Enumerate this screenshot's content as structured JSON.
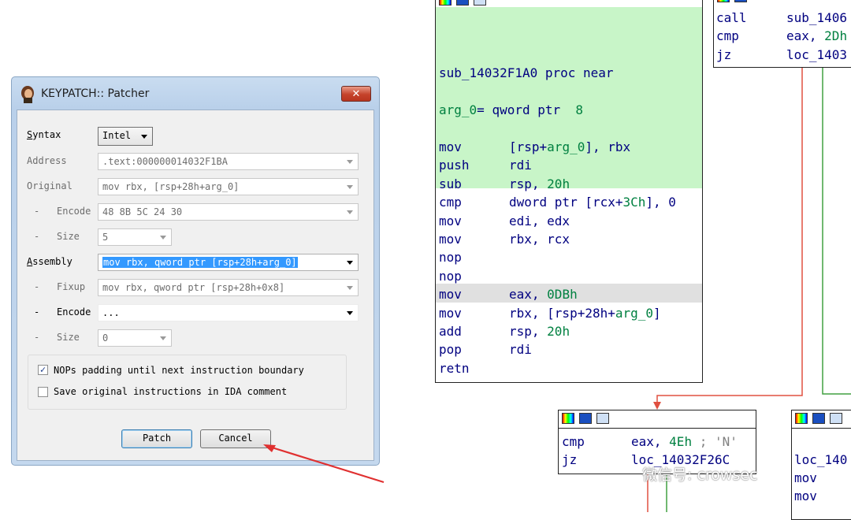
{
  "dialog": {
    "title": "KEYPATCH:: Patcher",
    "close_glyph": "✕",
    "syntax_label_u": "S",
    "syntax_label_rest": "yntax",
    "syntax_value": "Intel",
    "address_label": "Address",
    "address_value": ".text:000000014032F1BA",
    "original_label": "Original",
    "original_value": "mov rbx, [rsp+28h+arg_0]",
    "dash": "-",
    "encode_label": "Encode",
    "encode_value": "48 8B 5C 24 30",
    "size_label": "Size",
    "size_value": "5",
    "assembly_label_u": "A",
    "assembly_label_rest": "ssembly",
    "assembly_value": "mov rbx, qword ptr [rsp+28h+arg_0]",
    "fixup_label": "Fixup",
    "fixup_value": "mov rbx, qword ptr [rsp+28h+0x8]",
    "encode2_label": "Encode",
    "encode2_value": "...",
    "size2_label": "Size",
    "size2_value": "0",
    "nops_checkbox_label": "NOPs padding until next instruction boundary",
    "nops_checked": true,
    "save_checkbox_label": "Save original instructions in IDA comment",
    "save_checked": false,
    "check_glyph": "✓",
    "patch_button": "Patch",
    "cancel_button": "Cancel"
  },
  "ida": {
    "main_block": {
      "proc_line": "sub_14032F1A0 proc near",
      "arg_line_name": "arg_0",
      "arg_line_rest": "= qword ptr  ",
      "arg_line_num": "8",
      "rows": [
        {
          "mn": "mov",
          "op": "[rsp+",
          "op2": "arg_0",
          "op3": "], rbx"
        },
        {
          "mn": "push",
          "op": "rdi",
          "op2": "",
          "op3": ""
        },
        {
          "mn": "sub",
          "op": "rsp, ",
          "op2": "20h",
          "op3": ""
        },
        {
          "mn": "cmp",
          "op": "dword ptr [rcx+",
          "op2": "3Ch",
          "op3": "], 0"
        },
        {
          "mn": "mov",
          "op": "edi, edx",
          "op2": "",
          "op3": ""
        },
        {
          "mn": "mov",
          "op": "rbx, rcx",
          "op2": "",
          "op3": ""
        },
        {
          "mn": "nop",
          "op": "",
          "op2": "",
          "op3": ""
        },
        {
          "mn": "nop",
          "op": "",
          "op2": "",
          "op3": ""
        },
        {
          "mn": "mov",
          "op": "eax, ",
          "op2": "0DBh",
          "op3": ""
        },
        {
          "mn": "mov",
          "op": "rbx, [rsp+28h+",
          "op2": "arg_0",
          "op3": "]"
        },
        {
          "mn": "add",
          "op": "rsp, ",
          "op2": "20h",
          "op3": ""
        },
        {
          "mn": "pop",
          "op": "rdi",
          "op2": "",
          "op3": ""
        },
        {
          "mn": "retn",
          "op": "",
          "op2": "",
          "op3": ""
        }
      ]
    },
    "top_right_block": {
      "rows": [
        {
          "mn": "call",
          "op": "sub_1406"
        },
        {
          "mn": "cmp",
          "op": "eax, ",
          "op2": "2Dh"
        },
        {
          "mn": "jz",
          "op": "loc_1403"
        }
      ]
    },
    "mid_block": {
      "row1_mn": "cmp",
      "row1_op": "eax, ",
      "row1_num": "4Eh",
      "row1_cmt": " ; 'N'",
      "row2_mn": "jz",
      "row2_op": "loc_14032F26C"
    },
    "right_block": {
      "row1": "loc_140",
      "row2": "mov",
      "row3": "mov"
    }
  },
  "watermark": "微信号: crowsec",
  "colors": {
    "green_block": "#c8f5c8",
    "edge_red": "#e05040",
    "edge_green": "#40a040",
    "annotation_arrow": "#e03030"
  }
}
